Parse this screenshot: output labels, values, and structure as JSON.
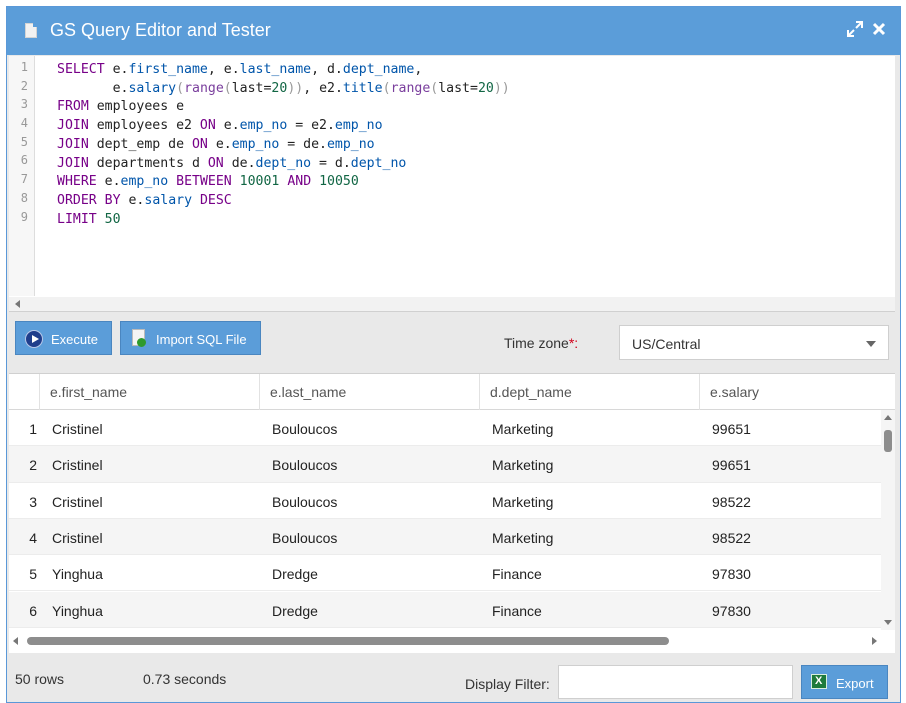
{
  "window": {
    "title": "GS Query Editor and Tester",
    "title_bar_color": "#5b9dd9"
  },
  "editor": {
    "line_numbers": [
      "1",
      "2",
      "3",
      "4",
      "5",
      "6",
      "7",
      "8",
      "9"
    ],
    "query_lines": [
      "SELECT e.first_name, e.last_name, d.dept_name,",
      "       e.salary(range(last=20)), e2.title(range(last=20))",
      "FROM employees e",
      "JOIN employees e2 ON e.emp_no = e2.emp_no",
      "JOIN dept_emp de ON e.emp_no = de.emp_no",
      "JOIN departments d ON de.dept_no = d.dept_no",
      "WHERE e.emp_no BETWEEN 10001 AND 10050",
      "ORDER BY e.salary DESC",
      "LIMIT 50"
    ]
  },
  "toolbar": {
    "execute_label": "Execute",
    "import_label": "Import SQL File",
    "timezone_label": "Time zone",
    "timezone_required_mark": "*:",
    "timezone_value": "US/Central"
  },
  "results": {
    "columns": [
      "e.first_name",
      "e.last_name",
      "d.dept_name",
      "e.salary"
    ],
    "rows": [
      {
        "n": "1",
        "first_name": "Cristinel",
        "last_name": "Bouloucos",
        "dept_name": "Marketing",
        "salary": "99651"
      },
      {
        "n": "2",
        "first_name": "Cristinel",
        "last_name": "Bouloucos",
        "dept_name": "Marketing",
        "salary": "99651"
      },
      {
        "n": "3",
        "first_name": "Cristinel",
        "last_name": "Bouloucos",
        "dept_name": "Marketing",
        "salary": "98522"
      },
      {
        "n": "4",
        "first_name": "Cristinel",
        "last_name": "Bouloucos",
        "dept_name": "Marketing",
        "salary": "98522"
      },
      {
        "n": "5",
        "first_name": "Yinghua",
        "last_name": "Dredge",
        "dept_name": "Finance",
        "salary": "97830"
      },
      {
        "n": "6",
        "first_name": "Yinghua",
        "last_name": "Dredge",
        "dept_name": "Finance",
        "salary": "97830"
      }
    ]
  },
  "footer": {
    "row_count": "50 rows",
    "elapsed": "0.73 seconds",
    "filter_label": "Display Filter:",
    "filter_value": "",
    "export_label": "Export"
  }
}
